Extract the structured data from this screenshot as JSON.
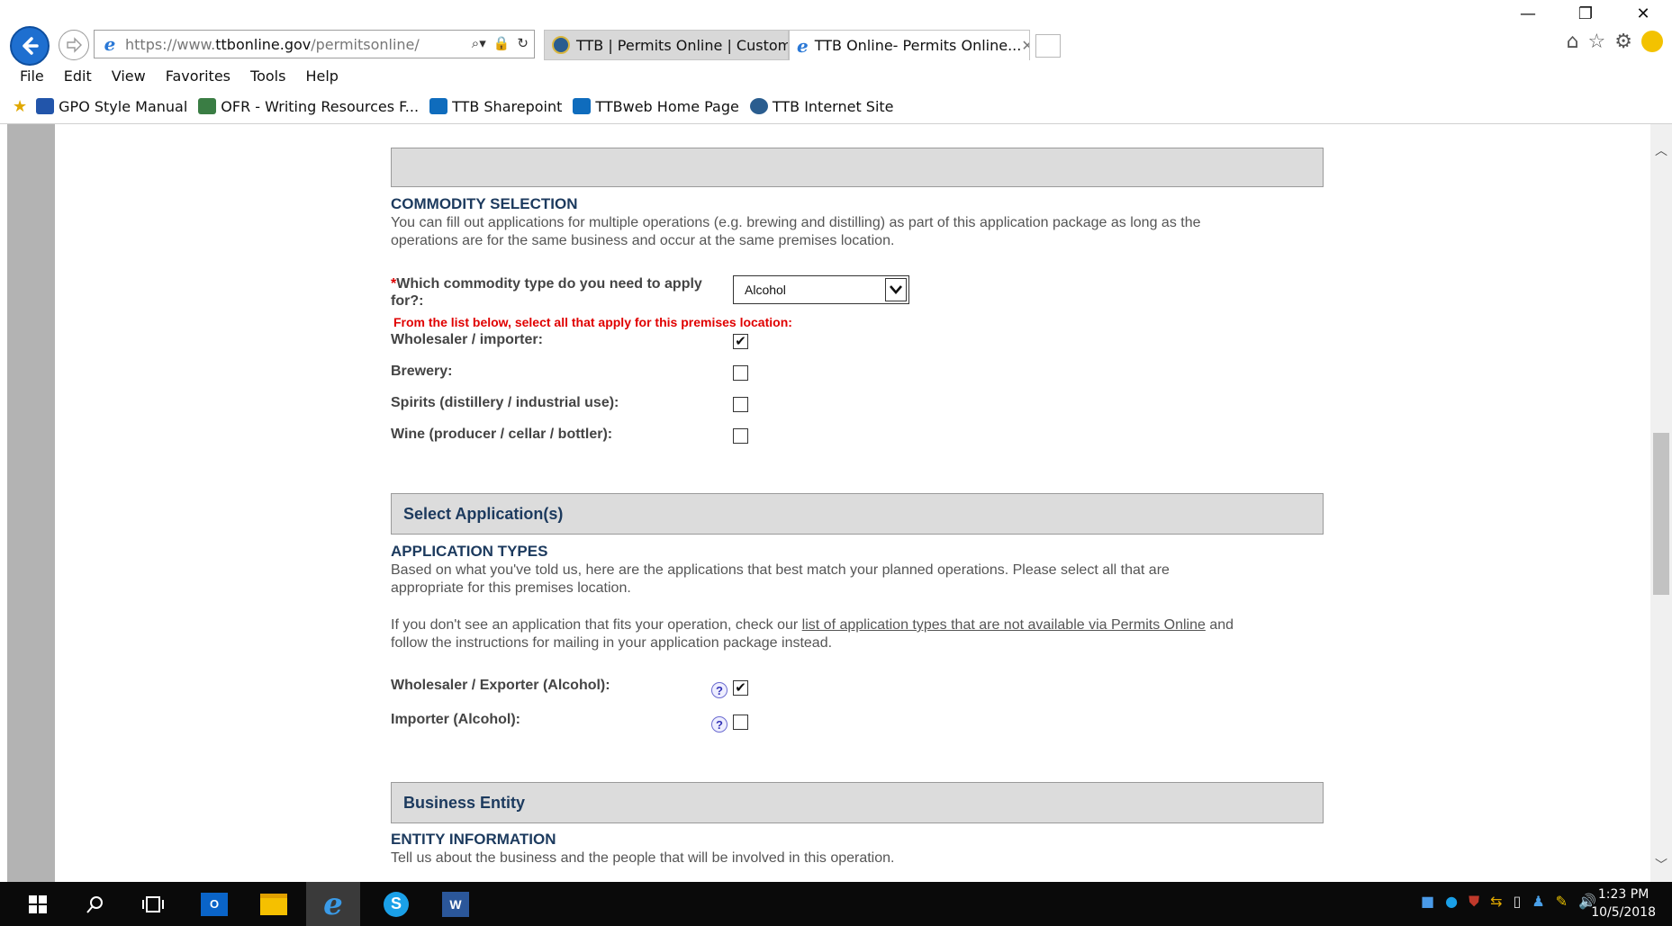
{
  "window": {
    "minimize": "—",
    "restore": "❐",
    "close": "✕"
  },
  "address_bar": {
    "url_prefix": "https://www.",
    "url_domain": "ttbonline.gov",
    "url_path": "/permitsonline/"
  },
  "tabs": [
    {
      "title": "TTB | Permits Online | Custom...",
      "icon": "ttb-seal-icon",
      "active": false
    },
    {
      "title": "TTB Online- Permits Online...",
      "icon": "ie-icon",
      "active": true,
      "close": "✕"
    }
  ],
  "menu": [
    "File",
    "Edit",
    "View",
    "Favorites",
    "Tools",
    "Help"
  ],
  "favorites": [
    {
      "label": "GPO Style Manual",
      "icon": "gpo-icon",
      "color": "#2255aa"
    },
    {
      "label": "OFR - Writing Resources F...",
      "icon": "ofr-icon",
      "color": "#3a7d44"
    },
    {
      "label": "TTB Sharepoint",
      "icon": "sharepoint-icon",
      "color": "#0f6cbd"
    },
    {
      "label": "TTBweb Home Page",
      "icon": "sharepoint-icon",
      "color": "#0f6cbd"
    },
    {
      "label": "TTB Internet Site",
      "icon": "ttb-seal-icon",
      "color": "#2a5d8f"
    }
  ],
  "commodity": {
    "heading": "COMMODITY SELECTION",
    "intro_line1": "You can fill out applications for multiple operations (e.g. brewing and distilling) as part of this application package as long as the",
    "intro_line2": "operations are for the same business and occur at the same premises location.",
    "question_required_mark": "*",
    "question_line1": "Which commodity type do you need to apply",
    "question_line2": "for?:",
    "selected_commodity": "Alcohol",
    "instruction": "From the list below, select all that apply for this premises location:",
    "options": [
      {
        "label": "Wholesaler / importer:",
        "checked": true
      },
      {
        "label": "Brewery:",
        "checked": false
      },
      {
        "label": "Spirits (distillery / industrial use):",
        "checked": false
      },
      {
        "label": "Wine (producer / cellar / bottler):",
        "checked": false
      }
    ]
  },
  "select_application": {
    "section_title": "Select Application(s)",
    "heading": "APPLICATION TYPES",
    "intro_line1": "Based on what you've told us, here are the applications that best match your planned operations. Please select all that are",
    "intro_line2": "appropriate for this premises location.",
    "note_before_link": "If you don't see an application that fits your operation, check our ",
    "note_link": "list of application types that are not available via Permits Online",
    "note_after_link": " and",
    "note_line2": "follow the instructions for mailing in your application package instead.",
    "help_symbol": "?",
    "applications": [
      {
        "label": "Wholesaler / Exporter (Alcohol):",
        "checked": true
      },
      {
        "label": "Importer (Alcohol):",
        "checked": false
      }
    ]
  },
  "business_entity": {
    "section_title": "Business Entity",
    "heading": "ENTITY INFORMATION",
    "intro": "Tell us about the business and the people that will be involved in this operation."
  },
  "checkmark": "✔",
  "taskbar": {
    "time": "1:23 PM",
    "date": "10/5/2018",
    "apps": [
      "start-icon",
      "search-icon",
      "task-view-icon",
      "outlook-icon",
      "file-explorer-icon",
      "internet-explorer-icon",
      "skype-icon",
      "word-icon"
    ]
  }
}
